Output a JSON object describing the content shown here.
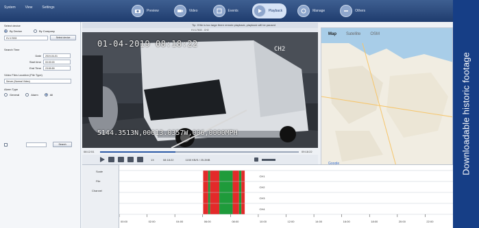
{
  "menu": [
    "System",
    "View",
    "Settings"
  ],
  "toolbar": [
    {
      "label": "Preview",
      "icon": "camera-icon"
    },
    {
      "label": "Video",
      "icon": "video-icon"
    },
    {
      "label": "Events",
      "icon": "events-icon"
    },
    {
      "label": "Playback",
      "icon": "playback-icon",
      "active": true
    },
    {
      "label": "Manage",
      "icon": "manage-icon"
    },
    {
      "label": "Others",
      "icon": "others-icon"
    }
  ],
  "left_panel": {
    "select_device": "Select device",
    "by_device": "By Device",
    "by_company": "By Company",
    "device_value": "KV-17633",
    "select_device_button": "Select device",
    "search_time": "Search Time",
    "date_label": "Date",
    "date_value": "2019-04-01",
    "start_label": "Start time",
    "start_value": "00:00:00",
    "end_label": "End Time",
    "end_value": "23:59:59",
    "location_label": "Video Files Location (File Type)",
    "location_value": "Server (Normal Video)",
    "alarm_type": "Alarm Type",
    "general": "General",
    "alarm": "Alarm",
    "all": "All",
    "search_button": "Search"
  },
  "video": {
    "title": "KV-17633 - CH2",
    "info": "Tip: If file is too large there remote playback, playback will be paused",
    "osd_date": "01-04-2019 08:18:22",
    "osd_channel": "CH2",
    "osd_gps": "5144.3513N,00013.0357W,006,0000MPH"
  },
  "map": {
    "tabs": [
      "Map",
      "Satellite",
      "OSM"
    ],
    "selected_tab": "Map",
    "logo": "Google"
  },
  "controls": {
    "time_start": "08:12:51",
    "time_end": "09:18:22",
    "speed": "1X",
    "current": "08:18:22",
    "size": "1150 KB/S / 25.2MB"
  },
  "timeline": {
    "left_labels": [
      "Scale",
      "File",
      "Channel"
    ],
    "channels": [
      "CH1",
      "CH2",
      "CH3",
      "CH4"
    ],
    "ticks": [
      "00:00",
      "02:00",
      "04:00",
      "06:00",
      "08:00",
      "10:00",
      "12:00",
      "14:00",
      "16:00",
      "18:00",
      "20:00",
      "22:00"
    ]
  },
  "banner": {
    "text": "Downloadable historic footage"
  },
  "colors": {
    "header": "#1f3c6e",
    "banner": "#163e86",
    "normal_record": "#e32a2a",
    "alarm_record": "#1f9b3b"
  }
}
